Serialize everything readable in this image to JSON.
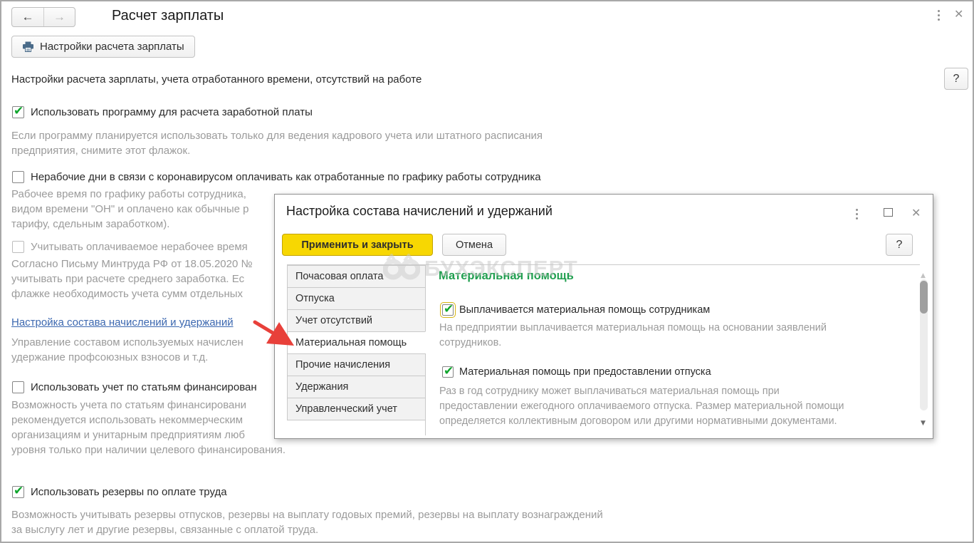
{
  "page": {
    "title": "Расчет зарплаты",
    "toolbar_button_label": "Настройки расчета зарплаты",
    "description": "Настройки расчета зарплаты, учета отработанного времени, отсутствий на работе",
    "help_label": "?"
  },
  "settings": {
    "use_program": {
      "label": "Использовать программу для расчета заработной платы",
      "checked": true,
      "comment": [
        "Если программу планируется использовать только для ведения кадрового учета или штатного расписания",
        "предприятия, снимите этот флажок."
      ]
    },
    "covid_days": {
      "label": "Нерабочие дни в связи с коронавирусом оплачивать как отработанные по графику работы сотрудника",
      "checked": false,
      "comment": [
        "Рабочее время по графику работы сотрудника,",
        "видом времени \"ОН\" и оплачено как обычные р",
        "тарифу, сдельным заработком)."
      ]
    },
    "paid_nonworking": {
      "label": "Учитывать оплачиваемое нерабочее время",
      "checked": false,
      "disabled": true
    },
    "mintrud_comment": [
      "Согласно Письму Минтруда РФ от 18.05.2020 №",
      "учитывать при расчете среднего заработка. Ес",
      "флажке необходимость учета сумм отдельных"
    ],
    "accruals_link": {
      "label": "Настройка состава начислений и удержаний",
      "comment": [
        "Управление составом используемых начислен",
        "удержание профсоюзных взносов и т.д."
      ]
    },
    "financing": {
      "label": "Использовать учет по статьям финансирован",
      "checked": false,
      "comment": [
        "Возможность учета по статьям финансировани",
        "рекомендуется использовать некоммерческим",
        "организациям и унитарным предприятиям люб",
        "уровня только при наличии целевого финансирования."
      ]
    },
    "reserves": {
      "label": "Использовать резервы по оплате труда",
      "checked": true,
      "comment": [
        "Возможность учитывать резервы отпусков,  резервы на выплату годовых премий, резервы на выплату вознаграждений",
        "за выслугу лет и другие резервы, связанные с оплатой труда."
      ]
    }
  },
  "dialog": {
    "title": "Настройка состава начислений и удержаний",
    "apply_label": "Применить и закрыть",
    "cancel_label": "Отмена",
    "help_label": "?",
    "tabs": [
      "Почасовая оплата",
      "Отпуска",
      "Учет отсутствий",
      "Материальная помощь",
      "Прочие начисления",
      "Удержания",
      "Управленческий учет"
    ],
    "selected_tab": "Материальная помощь",
    "content": {
      "heading": "Материальная помощь",
      "pay_material_help": {
        "label": "Выплачивается материальная помощь сотрудникам",
        "checked": true,
        "comment": [
          "На предприятии выплачивается материальная помощь на основании заявлений",
          "сотрудников."
        ]
      },
      "vacation_material_help": {
        "label": "Материальная помощь при предоставлении отпуска",
        "checked": true,
        "comment": [
          "Раз в год сотруднику может выплачиваться материальная помощь при",
          "предоставлении ежегодного оплачиваемого отпуска. Размер материальной помощи",
          "определяется коллективным договором или другими нормативными документами."
        ]
      }
    }
  },
  "watermark": "БУХЭКСПЕРТ",
  "icons": {
    "back": "left-arrow",
    "forward": "right-arrow",
    "print": "printer",
    "menu": "kebab-three-dots",
    "close": "x-cross",
    "maximize": "square",
    "scroll_up": "triangle-up",
    "scroll_down": "triangle-down",
    "pointer": "red-arrow"
  },
  "colors": {
    "apply_button_yellow": "#f7d702",
    "heading_green": "#1f9e4e",
    "checkmark_green": "#0ea52c",
    "link_blue": "#3c68b0",
    "comment_gray": "#9b9b9b"
  }
}
